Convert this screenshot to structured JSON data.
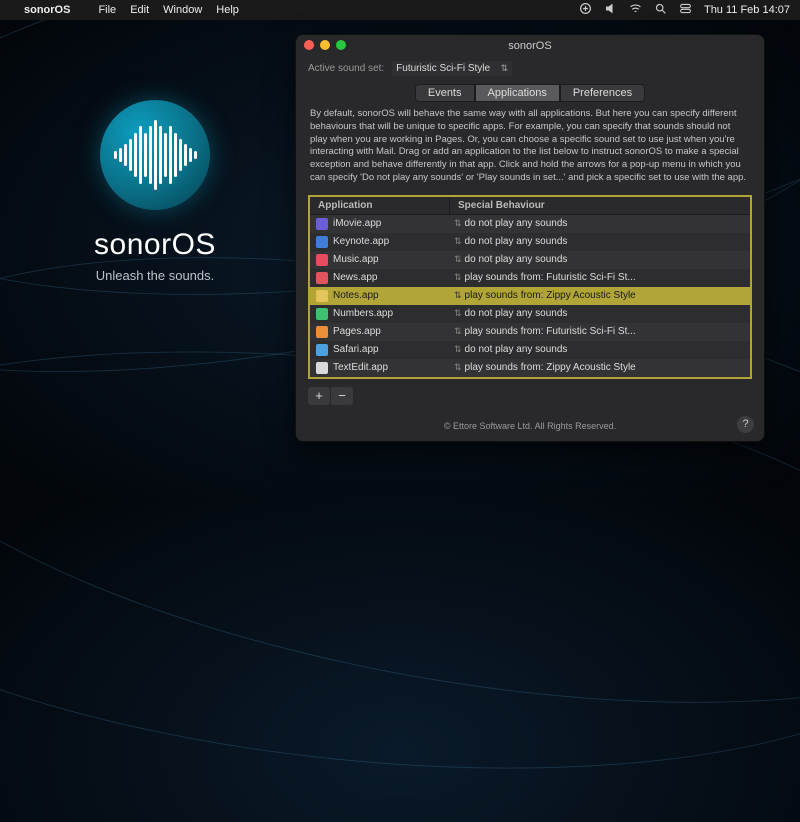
{
  "menubar": {
    "app": "sonorOS",
    "items": [
      "File",
      "Edit",
      "Window",
      "Help"
    ],
    "clock": "Thu 11 Feb  14:07"
  },
  "brand": {
    "title": "sonorOS",
    "tagline": "Unleash the sounds."
  },
  "window": {
    "title": "sonorOS",
    "soundset_label": "Active sound set:",
    "soundset_value": "Futuristic Sci-Fi Style",
    "tabs": [
      "Events",
      "Applications",
      "Preferences"
    ],
    "active_tab": 1,
    "description": "By default, sonorOS will behave the same way with all applications. But here you can specify different behaviours that will be unique to specific apps. For example, you can specify that sounds should not play when you are working in Pages. Or, you can choose a specific sound set to use just when you're interacting with Mail.  Drag or add an application to the list below to instruct sonorOS to make a special exception and behave differently in that app. Click and hold the arrows for a pop-up menu in which you can specify 'Do not play any sounds' or 'Play sounds in set...' and pick a specific set to use with the app.",
    "columns": [
      "Application",
      "Special Behaviour"
    ],
    "rows": [
      {
        "app": "iMovie.app",
        "behaviour": "do not play any sounds",
        "icon_color": "#6b5fd9",
        "selected": false
      },
      {
        "app": "Keynote.app",
        "behaviour": "do not play any sounds",
        "icon_color": "#3f7dd6",
        "selected": false
      },
      {
        "app": "Music.app",
        "behaviour": "do not play any sounds",
        "icon_color": "#e84a5f",
        "selected": false
      },
      {
        "app": "News.app",
        "behaviour": "play sounds from: Futuristic Sci-Fi St...",
        "icon_color": "#e0545b",
        "selected": false
      },
      {
        "app": "Notes.app",
        "behaviour": "play sounds from: Zippy Acoustic Style",
        "icon_color": "#e6c45c",
        "selected": true
      },
      {
        "app": "Numbers.app",
        "behaviour": "do not play any sounds",
        "icon_color": "#3fbf6f",
        "selected": false
      },
      {
        "app": "Pages.app",
        "behaviour": "play sounds from: Futuristic Sci-Fi St...",
        "icon_color": "#e98f3a",
        "selected": false
      },
      {
        "app": "Safari.app",
        "behaviour": "do not play any sounds",
        "icon_color": "#4aa3e0",
        "selected": false
      },
      {
        "app": "TextEdit.app",
        "behaviour": "play sounds from: Zippy Acoustic Style",
        "icon_color": "#d9d9de",
        "selected": false
      }
    ],
    "footer": "© Ettore Software Ltd. All Rights Reserved.",
    "add_label": "+",
    "remove_label": "−",
    "help_label": "?"
  },
  "logo_bars": [
    8,
    14,
    22,
    32,
    44,
    58,
    44,
    58,
    70,
    58,
    44,
    58,
    44,
    32,
    22,
    14,
    8
  ]
}
